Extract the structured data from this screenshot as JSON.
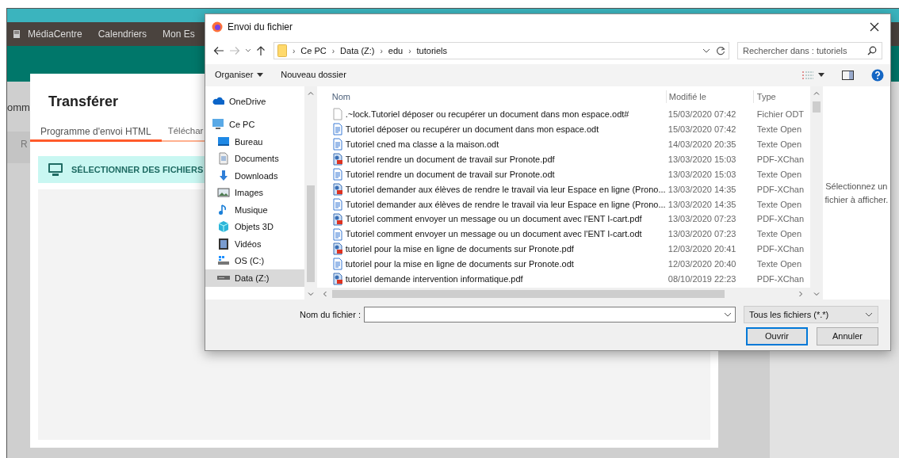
{
  "page": {
    "fragments": [
      "omm",
      "R"
    ],
    "nav": [
      {
        "label": "MédiaCentre",
        "icon": true
      },
      {
        "label": "Calendriers",
        "icon": false
      },
      {
        "label": "Mon Es",
        "icon": false
      }
    ],
    "modal": {
      "title": "Transférer",
      "tabs": [
        {
          "label": "Programme d'envoi HTML",
          "selected": true
        },
        {
          "label": "Téléchar",
          "selected": false
        }
      ],
      "select_button": "SÉLECTIONNER DES FICHIERS"
    }
  },
  "dialog": {
    "title": "Envoi du fichier",
    "path": [
      {
        "separator": "›",
        "label": "Ce PC"
      },
      {
        "separator": "›",
        "label": "Data (Z:)"
      },
      {
        "separator": "›",
        "label": "edu"
      },
      {
        "separator": "›",
        "label": "tutoriels"
      }
    ],
    "search": {
      "placeholder": "Rechercher dans : tutoriels"
    },
    "toolbar": [
      {
        "label": "Organiser",
        "dropdown": true
      },
      {
        "label": "Nouveau dossier",
        "dropdown": false
      }
    ],
    "nav": [
      {
        "label": "OneDrive",
        "kind": "cloud",
        "selected": false
      },
      {
        "label": "Ce PC",
        "kind": "computer",
        "selected": false,
        "children": [
          {
            "label": "Bureau",
            "kind": "desktop",
            "selected": false
          },
          {
            "label": "Documents",
            "kind": "documents",
            "selected": false
          },
          {
            "label": "Downloads",
            "kind": "downloads",
            "selected": false
          },
          {
            "label": "Images",
            "kind": "images",
            "selected": false
          },
          {
            "label": "Musique",
            "kind": "music",
            "selected": false
          },
          {
            "label": "Objets 3D",
            "kind": "objects",
            "selected": false
          },
          {
            "label": "Vidéos",
            "kind": "videos",
            "selected": false
          },
          {
            "label": "OS (C:)",
            "kind": "osdrive",
            "selected": false
          },
          {
            "label": "Data (Z:)",
            "kind": "drive",
            "selected": true
          }
        ]
      }
    ],
    "columns": [
      "Nom",
      "Modifié le",
      "Type"
    ],
    "files": [
      {
        "name": ".~lock.Tutoriel déposer ou recupérer un document dans mon espace.odt#",
        "modified": "15/03/2020 07:42",
        "type": "Fichier ODT",
        "kind": "blank"
      },
      {
        "name": "Tutoriel déposer ou recupérer un document dans mon espace.odt",
        "modified": "15/03/2020 07:42",
        "type": "Texte Open",
        "kind": "odt"
      },
      {
        "name": "Tutoriel cned ma classe a la maison.odt",
        "modified": "14/03/2020 20:35",
        "type": "Texte Open",
        "kind": "odt"
      },
      {
        "name": "Tutoriel rendre un document de travail sur Pronote.pdf",
        "modified": "13/03/2020 15:03",
        "type": "PDF-XChan",
        "kind": "pdf"
      },
      {
        "name": "Tutoriel rendre un document de travail sur Pronote.odt",
        "modified": "13/03/2020 15:03",
        "type": "Texte Open",
        "kind": "odt"
      },
      {
        "name": "Tutoriel demander aux élèves de rendre le travail via leur Espace en ligne (Prono...",
        "modified": "13/03/2020 14:35",
        "type": "PDF-XChan",
        "kind": "pdf"
      },
      {
        "name": "Tutoriel demander aux élèves de rendre le travail via leur Espace en ligne (Prono...",
        "modified": "13/03/2020 14:35",
        "type": "Texte Open",
        "kind": "odt"
      },
      {
        "name": "Tutoriel comment envoyer un message ou un document avec l'ENT I-cart.pdf",
        "modified": "13/03/2020 07:23",
        "type": "PDF-XChan",
        "kind": "pdf"
      },
      {
        "name": "Tutoriel comment envoyer un message ou un document avec l'ENT I-cart.odt",
        "modified": "13/03/2020 07:23",
        "type": "Texte Open",
        "kind": "odt"
      },
      {
        "name": "tutoriel pour la mise en ligne de documents sur Pronote.pdf",
        "modified": "12/03/2020 20:41",
        "type": "PDF-XChan",
        "kind": "pdf"
      },
      {
        "name": "tutoriel pour la mise en ligne de documents sur Pronote.odt",
        "modified": "12/03/2020 20:40",
        "type": "Texte Open",
        "kind": "odt"
      },
      {
        "name": "tutoriel demande intervention informatique.pdf",
        "modified": "08/10/2019 22:23",
        "type": "PDF-XChan",
        "kind": "pdf"
      }
    ],
    "preview_message": "Sélectionnez un fichier à afficher.",
    "file_name": {
      "label": "Nom du fichier :"
    },
    "filter": "Tous les fichiers (*.*)",
    "buttons": [
      {
        "label": "Ouvrir",
        "default": true
      },
      {
        "label": "Annuler",
        "default": false
      }
    ]
  }
}
